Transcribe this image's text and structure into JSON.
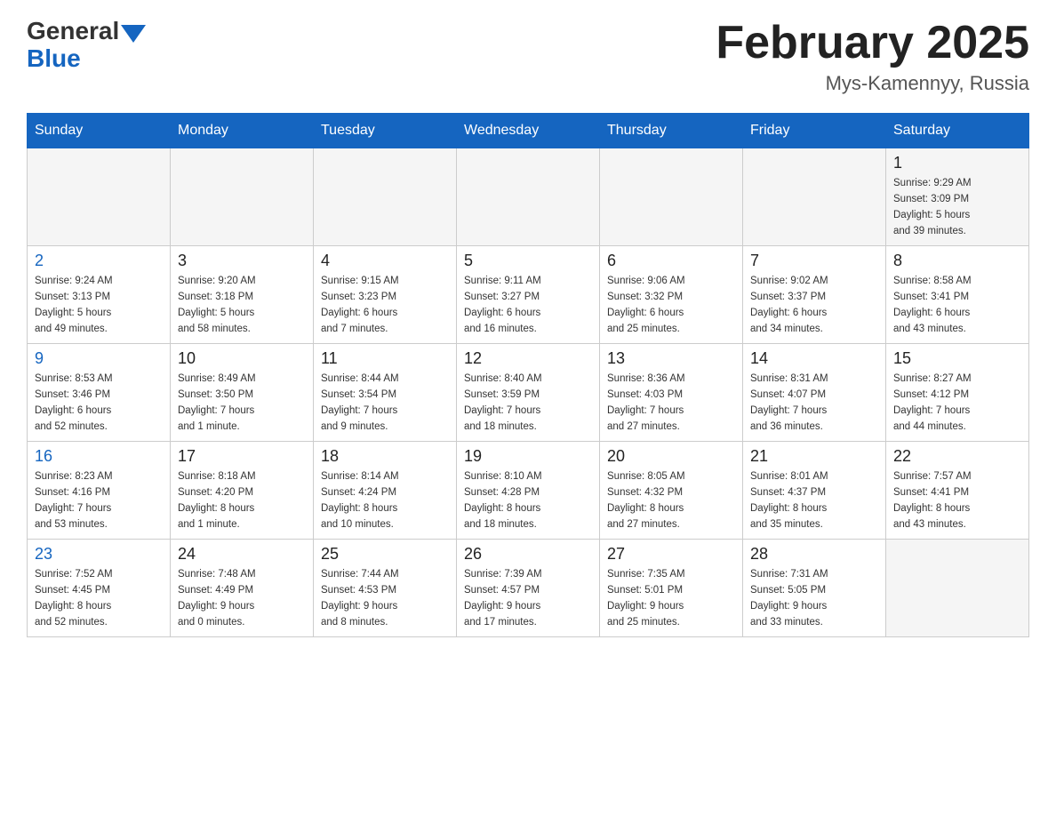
{
  "header": {
    "logo_general": "General",
    "logo_blue": "Blue",
    "month_year": "February 2025",
    "location": "Mys-Kamennyy, Russia"
  },
  "days_of_week": [
    "Sunday",
    "Monday",
    "Tuesday",
    "Wednesday",
    "Thursday",
    "Friday",
    "Saturday"
  ],
  "weeks": [
    [
      {
        "day": "",
        "info": ""
      },
      {
        "day": "",
        "info": ""
      },
      {
        "day": "",
        "info": ""
      },
      {
        "day": "",
        "info": ""
      },
      {
        "day": "",
        "info": ""
      },
      {
        "day": "",
        "info": ""
      },
      {
        "day": "1",
        "info": "Sunrise: 9:29 AM\nSunset: 3:09 PM\nDaylight: 5 hours\nand 39 minutes."
      }
    ],
    [
      {
        "day": "2",
        "info": "Sunrise: 9:24 AM\nSunset: 3:13 PM\nDaylight: 5 hours\nand 49 minutes."
      },
      {
        "day": "3",
        "info": "Sunrise: 9:20 AM\nSunset: 3:18 PM\nDaylight: 5 hours\nand 58 minutes."
      },
      {
        "day": "4",
        "info": "Sunrise: 9:15 AM\nSunset: 3:23 PM\nDaylight: 6 hours\nand 7 minutes."
      },
      {
        "day": "5",
        "info": "Sunrise: 9:11 AM\nSunset: 3:27 PM\nDaylight: 6 hours\nand 16 minutes."
      },
      {
        "day": "6",
        "info": "Sunrise: 9:06 AM\nSunset: 3:32 PM\nDaylight: 6 hours\nand 25 minutes."
      },
      {
        "day": "7",
        "info": "Sunrise: 9:02 AM\nSunset: 3:37 PM\nDaylight: 6 hours\nand 34 minutes."
      },
      {
        "day": "8",
        "info": "Sunrise: 8:58 AM\nSunset: 3:41 PM\nDaylight: 6 hours\nand 43 minutes."
      }
    ],
    [
      {
        "day": "9",
        "info": "Sunrise: 8:53 AM\nSunset: 3:46 PM\nDaylight: 6 hours\nand 52 minutes."
      },
      {
        "day": "10",
        "info": "Sunrise: 8:49 AM\nSunset: 3:50 PM\nDaylight: 7 hours\nand 1 minute."
      },
      {
        "day": "11",
        "info": "Sunrise: 8:44 AM\nSunset: 3:54 PM\nDaylight: 7 hours\nand 9 minutes."
      },
      {
        "day": "12",
        "info": "Sunrise: 8:40 AM\nSunset: 3:59 PM\nDaylight: 7 hours\nand 18 minutes."
      },
      {
        "day": "13",
        "info": "Sunrise: 8:36 AM\nSunset: 4:03 PM\nDaylight: 7 hours\nand 27 minutes."
      },
      {
        "day": "14",
        "info": "Sunrise: 8:31 AM\nSunset: 4:07 PM\nDaylight: 7 hours\nand 36 minutes."
      },
      {
        "day": "15",
        "info": "Sunrise: 8:27 AM\nSunset: 4:12 PM\nDaylight: 7 hours\nand 44 minutes."
      }
    ],
    [
      {
        "day": "16",
        "info": "Sunrise: 8:23 AM\nSunset: 4:16 PM\nDaylight: 7 hours\nand 53 minutes."
      },
      {
        "day": "17",
        "info": "Sunrise: 8:18 AM\nSunset: 4:20 PM\nDaylight: 8 hours\nand 1 minute."
      },
      {
        "day": "18",
        "info": "Sunrise: 8:14 AM\nSunset: 4:24 PM\nDaylight: 8 hours\nand 10 minutes."
      },
      {
        "day": "19",
        "info": "Sunrise: 8:10 AM\nSunset: 4:28 PM\nDaylight: 8 hours\nand 18 minutes."
      },
      {
        "day": "20",
        "info": "Sunrise: 8:05 AM\nSunset: 4:32 PM\nDaylight: 8 hours\nand 27 minutes."
      },
      {
        "day": "21",
        "info": "Sunrise: 8:01 AM\nSunset: 4:37 PM\nDaylight: 8 hours\nand 35 minutes."
      },
      {
        "day": "22",
        "info": "Sunrise: 7:57 AM\nSunset: 4:41 PM\nDaylight: 8 hours\nand 43 minutes."
      }
    ],
    [
      {
        "day": "23",
        "info": "Sunrise: 7:52 AM\nSunset: 4:45 PM\nDaylight: 8 hours\nand 52 minutes."
      },
      {
        "day": "24",
        "info": "Sunrise: 7:48 AM\nSunset: 4:49 PM\nDaylight: 9 hours\nand 0 minutes."
      },
      {
        "day": "25",
        "info": "Sunrise: 7:44 AM\nSunset: 4:53 PM\nDaylight: 9 hours\nand 8 minutes."
      },
      {
        "day": "26",
        "info": "Sunrise: 7:39 AM\nSunset: 4:57 PM\nDaylight: 9 hours\nand 17 minutes."
      },
      {
        "day": "27",
        "info": "Sunrise: 7:35 AM\nSunset: 5:01 PM\nDaylight: 9 hours\nand 25 minutes."
      },
      {
        "day": "28",
        "info": "Sunrise: 7:31 AM\nSunset: 5:05 PM\nDaylight: 9 hours\nand 33 minutes."
      },
      {
        "day": "",
        "info": ""
      }
    ]
  ]
}
